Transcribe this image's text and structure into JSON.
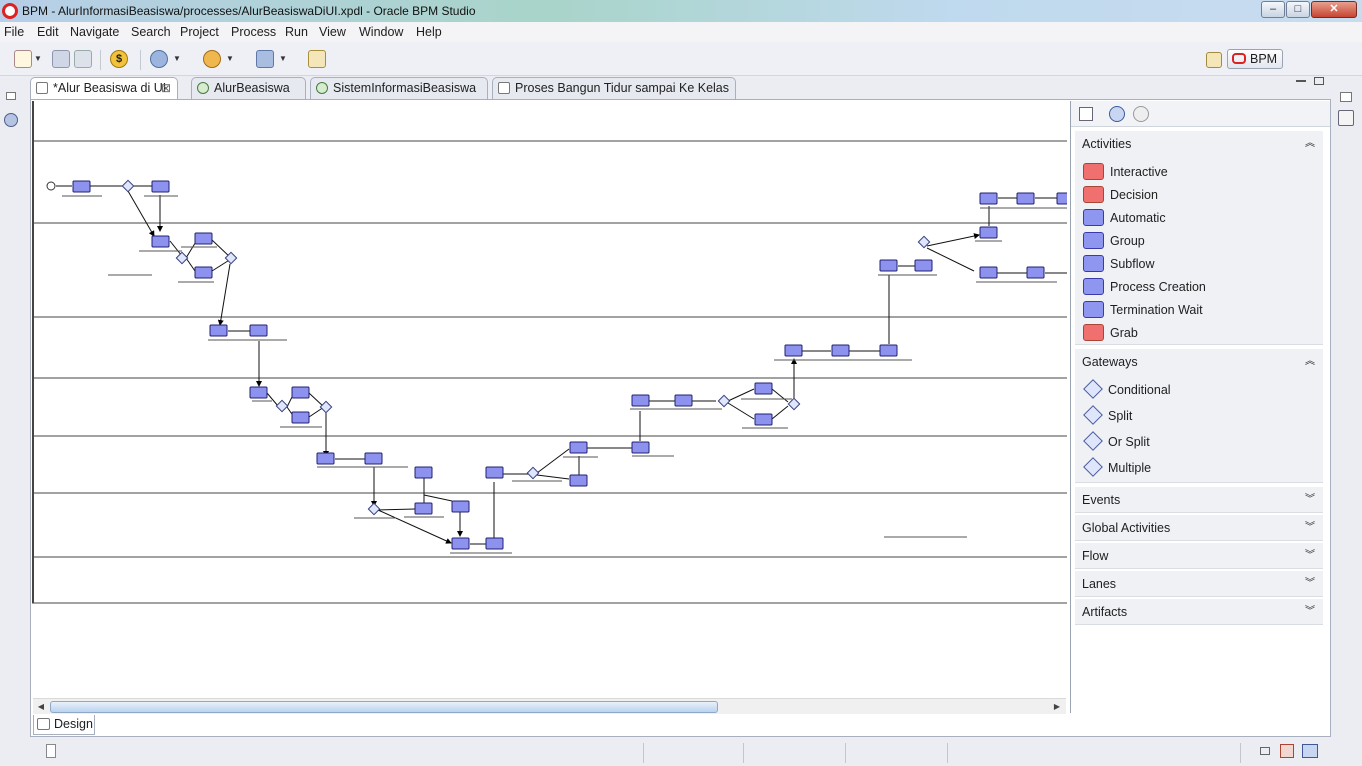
{
  "window": {
    "title": "BPM - AlurInformasiBeasiswa/processes/AlurBeasiswaDiUI.xpdl - Oracle BPM Studio"
  },
  "menu": [
    "File",
    "Edit",
    "Navigate",
    "Search",
    "Project",
    "Process",
    "Run",
    "View",
    "Window",
    "Help"
  ],
  "perspective": {
    "label": "BPM"
  },
  "tabs": [
    {
      "label": "*Alur Beasiswa di UI",
      "active": true,
      "icon": "process-icon"
    },
    {
      "label": "AlurBeasiswa",
      "active": false,
      "icon": "process-play-icon"
    },
    {
      "label": "SistemInformasiBeasiswa",
      "active": false,
      "icon": "process-play-icon"
    },
    {
      "label": "Proses Bangun Tidur sampai Ke Kelas",
      "active": false,
      "icon": "process-icon"
    }
  ],
  "editor_bottom_tab": {
    "label": "Design"
  },
  "palette": {
    "activities": {
      "title": "Activities",
      "items": [
        {
          "label": "Interactive",
          "icon": "interactive-activity-icon",
          "color": "#f07070"
        },
        {
          "label": "Decision",
          "icon": "decision-activity-icon",
          "color": "#f07070"
        },
        {
          "label": "Automatic",
          "icon": "automatic-activity-icon",
          "color": "#8f96f0"
        },
        {
          "label": "Group",
          "icon": "group-activity-icon",
          "color": "#8f96f0"
        },
        {
          "label": "Subflow",
          "icon": "subflow-activity-icon",
          "color": "#8f96f0"
        },
        {
          "label": "Process Creation",
          "icon": "process-creation-icon",
          "color": "#8f96f0"
        },
        {
          "label": "Termination Wait",
          "icon": "termination-wait-icon",
          "color": "#8f96f0"
        },
        {
          "label": "Grab",
          "icon": "grab-activity-icon",
          "color": "#f07070"
        }
      ]
    },
    "gateways": {
      "title": "Gateways",
      "items": [
        {
          "label": "Conditional",
          "icon": "conditional-gateway-icon"
        },
        {
          "label": "Split",
          "icon": "split-gateway-icon"
        },
        {
          "label": "Or Split",
          "icon": "or-split-gateway-icon"
        },
        {
          "label": "Multiple",
          "icon": "multiple-gateway-icon"
        }
      ]
    },
    "collapsed_sections": [
      "Events",
      "Global Activities",
      "Flow",
      "Lanes",
      "Artifacts"
    ]
  }
}
